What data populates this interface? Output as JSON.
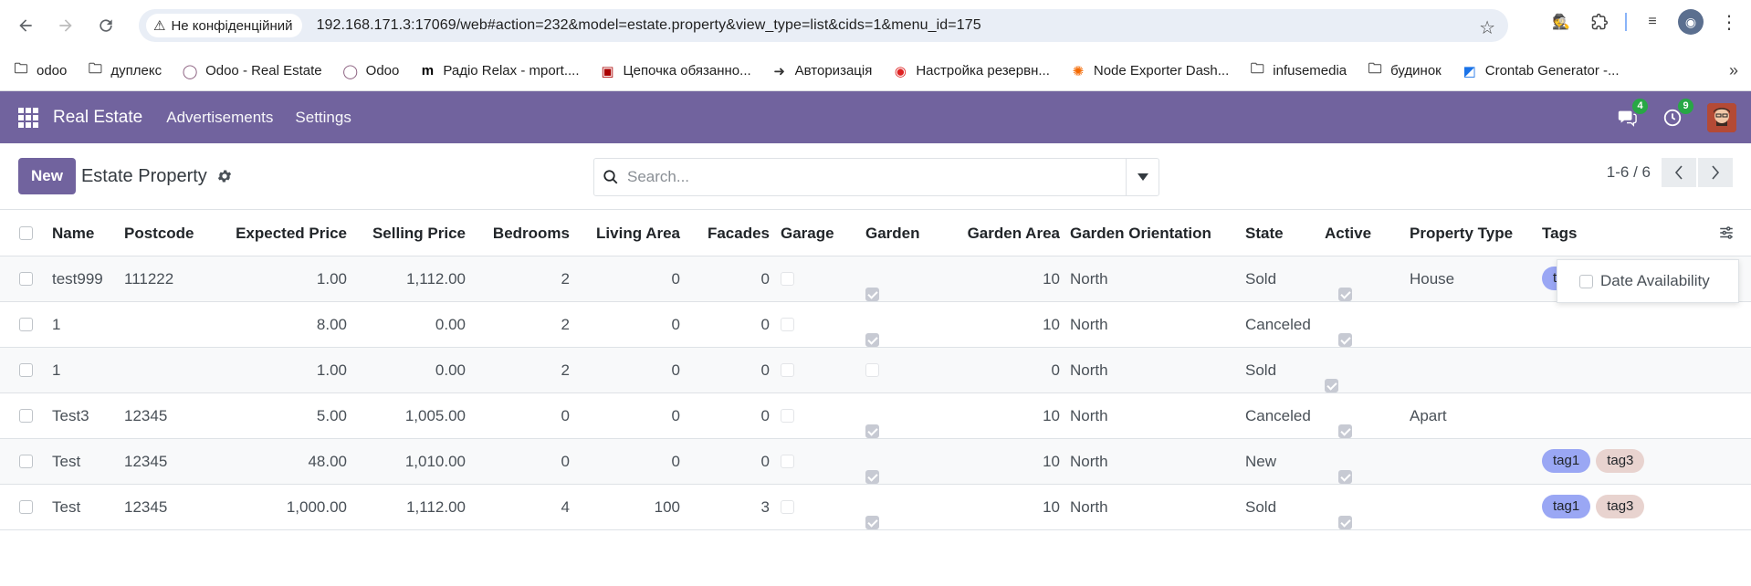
{
  "browser": {
    "security_label": "Не конфіденційний",
    "url": "192.168.171.3:17069/web#action=232&model=estate.property&view_type=list&cids=1&menu_id=175"
  },
  "bookmarks": [
    {
      "label": "odoo",
      "icon": "folder-icon"
    },
    {
      "label": "дуплекс",
      "icon": "folder-icon"
    },
    {
      "label": "Odoo - Real Estate",
      "icon": "odoo-icon"
    },
    {
      "label": "Odoo",
      "icon": "odoo-icon"
    },
    {
      "label": "Радіо Relax - mport....",
      "icon": "m-icon"
    },
    {
      "label": "Цепочка обязанно...",
      "icon": "site-icon"
    },
    {
      "label": "Авторизація",
      "icon": "login-icon"
    },
    {
      "label": "Настройка резервн...",
      "icon": "backup-icon"
    },
    {
      "label": "Node Exporter Dash...",
      "icon": "grafana-icon"
    },
    {
      "label": "infusemedia",
      "icon": "folder-icon"
    },
    {
      "label": "будинок",
      "icon": "folder-icon"
    },
    {
      "label": "Crontab Generator -...",
      "icon": "crontab-icon"
    }
  ],
  "odoo_nav": {
    "brand": "Real Estate",
    "menus": [
      "Advertisements",
      "Settings"
    ],
    "messages_count": "4",
    "activities_count": "9"
  },
  "control_panel": {
    "new_label": "New",
    "breadcrumb": "Estate Property",
    "search_placeholder": "Search...",
    "pager": "1-6 / 6"
  },
  "columns": [
    "Name",
    "Postcode",
    "Expected Price",
    "Selling Price",
    "Bedrooms",
    "Living Area",
    "Facades",
    "Garage",
    "Garden",
    "Garden Area",
    "Garden Orientation",
    "State",
    "Active",
    "Property Type",
    "Tags"
  ],
  "rows": [
    {
      "name": "test999",
      "postcode": "111222",
      "expected_price": "1.00",
      "selling_price": "1,112.00",
      "bedrooms": "2",
      "living_area": "0",
      "facades": "0",
      "garage": false,
      "garden": true,
      "garden_area": "10",
      "garden_orientation": "North",
      "state": "Sold",
      "active": true,
      "property_type": "House",
      "tags": [
        "tag1"
      ]
    },
    {
      "name": "1",
      "postcode": "",
      "expected_price": "8.00",
      "selling_price": "0.00",
      "bedrooms": "2",
      "living_area": "0",
      "facades": "0",
      "garage": false,
      "garden": true,
      "garden_area": "10",
      "garden_orientation": "North",
      "state": "Canceled",
      "active": true,
      "property_type": "",
      "tags": []
    },
    {
      "name": "1",
      "postcode": "",
      "expected_price": "1.00",
      "selling_price": "0.00",
      "bedrooms": "2",
      "living_area": "0",
      "facades": "0",
      "garage": false,
      "garden": false,
      "garden_area": "0",
      "garden_orientation": "North",
      "state": "Sold",
      "active": true,
      "property_type": "",
      "tags": []
    },
    {
      "name": "Test3",
      "postcode": "12345",
      "expected_price": "5.00",
      "selling_price": "1,005.00",
      "bedrooms": "0",
      "living_area": "0",
      "facades": "0",
      "garage": false,
      "garden": true,
      "garden_area": "10",
      "garden_orientation": "North",
      "state": "Canceled",
      "active": true,
      "property_type": "Apart",
      "tags": []
    },
    {
      "name": "Test",
      "postcode": "12345",
      "expected_price": "48.00",
      "selling_price": "1,010.00",
      "bedrooms": "0",
      "living_area": "0",
      "facades": "0",
      "garage": false,
      "garden": true,
      "garden_area": "10",
      "garden_orientation": "North",
      "state": "New",
      "active": true,
      "property_type": "",
      "tags": [
        "tag1",
        "tag3"
      ]
    },
    {
      "name": "Test",
      "postcode": "12345",
      "expected_price": "1,000.00",
      "selling_price": "1,112.00",
      "bedrooms": "4",
      "living_area": "100",
      "facades": "3",
      "garage": false,
      "garden": true,
      "garden_area": "10",
      "garden_orientation": "North",
      "state": "Sold",
      "active": true,
      "property_type": "",
      "tags": [
        "tag1",
        "tag3"
      ]
    }
  ],
  "optional_columns_popup": {
    "label": "Date Availability",
    "checked": false
  },
  "colors": {
    "odoo_primary": "#71639e",
    "tag1": "#9aa7f4",
    "tag3": "#e8d3cf",
    "badge": "#28a745"
  }
}
